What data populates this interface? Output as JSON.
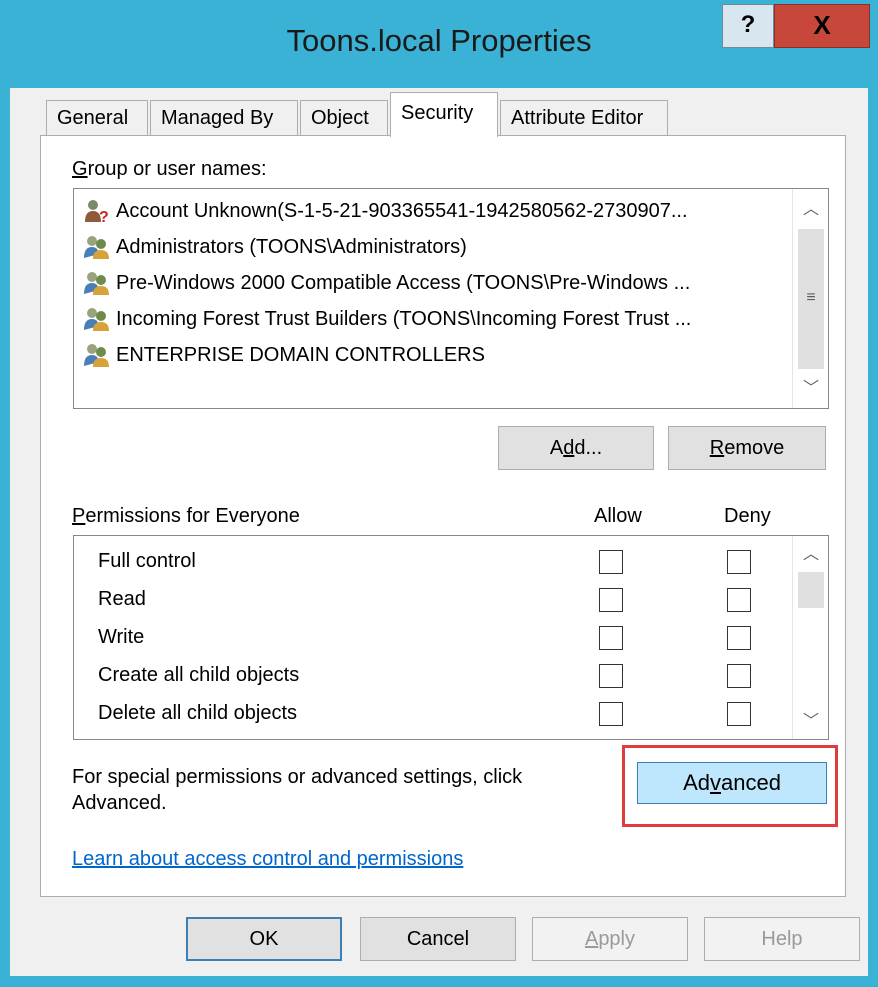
{
  "window": {
    "title": "Toons.local Properties",
    "help_label": "?",
    "close_label": "X"
  },
  "tabs": [
    {
      "label": "General"
    },
    {
      "label": "Managed By"
    },
    {
      "label": "Object"
    },
    {
      "label": "Security",
      "active": true
    },
    {
      "label": "Attribute Editor"
    }
  ],
  "security": {
    "group_label_hotkey": "G",
    "group_label_rest": "roup or user names:",
    "users": [
      {
        "name": "Account Unknown(S-1-5-21-903365541-1942580562-2730907...",
        "icon": "unknown-user-icon"
      },
      {
        "name": "Administrators (TOONS\\Administrators)",
        "icon": "group-icon"
      },
      {
        "name": "Pre-Windows 2000 Compatible Access (TOONS\\Pre-Windows ...",
        "icon": "group-icon"
      },
      {
        "name": "Incoming Forest Trust Builders (TOONS\\Incoming Forest Trust ...",
        "icon": "group-icon"
      },
      {
        "name": "ENTERPRISE DOMAIN CONTROLLERS",
        "icon": "group-icon"
      }
    ],
    "add_pre": "A",
    "add_hot": "d",
    "add_post": "d...",
    "remove_hot": "R",
    "remove_post": "emove",
    "perm_label_hot": "P",
    "perm_label_rest": "ermissions for Everyone",
    "allow_label": "Allow",
    "deny_label": "Deny",
    "permissions": [
      {
        "name": "Full control",
        "allow": false,
        "deny": false
      },
      {
        "name": "Read",
        "allow": false,
        "deny": false
      },
      {
        "name": "Write",
        "allow": false,
        "deny": false
      },
      {
        "name": "Create all child objects",
        "allow": false,
        "deny": false
      },
      {
        "name": "Delete all child objects",
        "allow": false,
        "deny": false
      }
    ],
    "special_text_line1": "For special permissions or advanced settings, click",
    "special_text_line2": "Advanced.",
    "advanced_pre": "Ad",
    "advanced_hot": "v",
    "advanced_post": "anced",
    "learn_link": "Learn about access control and permissions"
  },
  "footer": {
    "ok_label": "OK",
    "cancel_label": "Cancel",
    "apply_hot": "A",
    "apply_post": "pply",
    "help_label": "Help"
  },
  "colors": {
    "window_frame": "#3ab2d6",
    "close_button": "#c7483a",
    "advanced_button": "#bee6fd",
    "highlight": "#e03c3c",
    "link": "#0066cc"
  }
}
